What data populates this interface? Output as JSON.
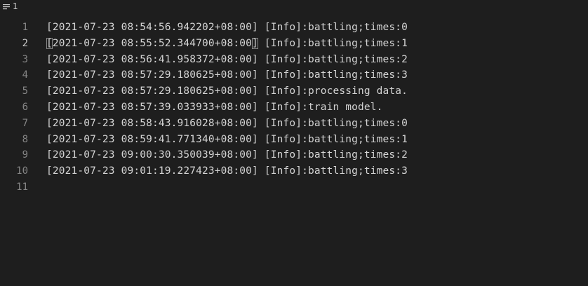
{
  "toolbar": {
    "list_icon": "list-lines-icon",
    "count_label": "1"
  },
  "editor": {
    "active_line": 2,
    "lines": [
      {
        "number": "1",
        "open": "[",
        "body": "2021-07-23 08:54:56.942202+08:00",
        "close": "]",
        "message": " [Info]:battling;times:0"
      },
      {
        "number": "2",
        "open": "[",
        "body": "2021-07-23 08:55:52.344700+08:00",
        "close": "]",
        "message": " [Info]:battling;times:1"
      },
      {
        "number": "3",
        "open": "[",
        "body": "2021-07-23 08:56:41.958372+08:00",
        "close": "]",
        "message": " [Info]:battling;times:2"
      },
      {
        "number": "4",
        "open": "[",
        "body": "2021-07-23 08:57:29.180625+08:00",
        "close": "]",
        "message": " [Info]:battling;times:3"
      },
      {
        "number": "5",
        "open": "[",
        "body": "2021-07-23 08:57:29.180625+08:00",
        "close": "]",
        "message": " [Info]:processing data."
      },
      {
        "number": "6",
        "open": "[",
        "body": "2021-07-23 08:57:39.033933+08:00",
        "close": "]",
        "message": " [Info]:train model."
      },
      {
        "number": "7",
        "open": "[",
        "body": "2021-07-23 08:58:43.916028+08:00",
        "close": "]",
        "message": " [Info]:battling;times:0"
      },
      {
        "number": "8",
        "open": "[",
        "body": "2021-07-23 08:59:41.771340+08:00",
        "close": "]",
        "message": " [Info]:battling;times:1"
      },
      {
        "number": "9",
        "open": "[",
        "body": "2021-07-23 09:00:30.350039+08:00",
        "close": "]",
        "message": " [Info]:battling;times:2"
      },
      {
        "number": "10",
        "open": "[",
        "body": "2021-07-23 09:01:19.227423+08:00",
        "close": "]",
        "message": " [Info]:battling;times:3"
      },
      {
        "number": "11",
        "open": "",
        "body": "",
        "close": "",
        "message": ""
      }
    ]
  }
}
